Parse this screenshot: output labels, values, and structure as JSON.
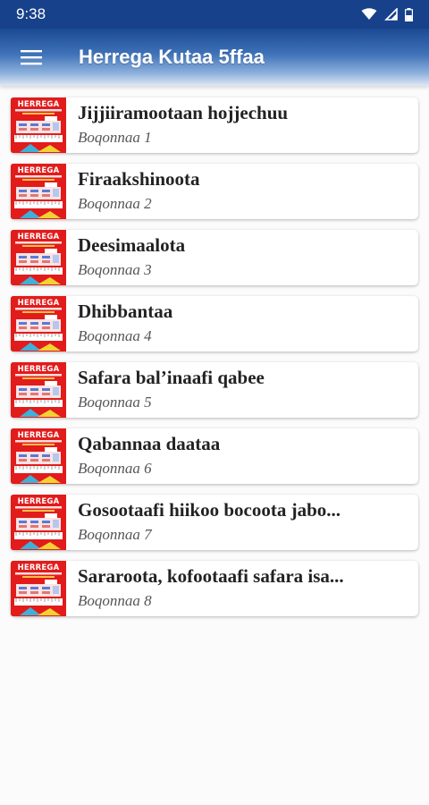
{
  "status": {
    "time": "9:38"
  },
  "appbar": {
    "title": "Herrega Kutaa 5ffaa",
    "menu_icon": "hamburger-menu-icon"
  },
  "colors": {
    "appbar_top": "#1a4a93",
    "thumb_red": "#e21b1b",
    "status_bar": "#17418a"
  },
  "thumbnail": {
    "title": "HERREGA"
  },
  "chapters": [
    {
      "title": "Jijjiiramootaan hojjechuu",
      "subtitle": "Boqonnaa 1"
    },
    {
      "title": "Firaakshinoota",
      "subtitle": "Boqonnaa 2"
    },
    {
      "title": "Deesimaalota",
      "subtitle": "Boqonnaa 3"
    },
    {
      "title": "Dhibbantaa",
      "subtitle": "Boqonnaa 4"
    },
    {
      "title": "Safara bal’inaafi qabee",
      "subtitle": "Boqonnaa 5"
    },
    {
      "title": "Qabannaa daataa",
      "subtitle": "Boqonnaa 6"
    },
    {
      "title": "Gosootaafi hiikoo bocoota jabo...",
      "subtitle": "Boqonnaa 7"
    },
    {
      "title": "Sararoota, kofootaafi safara isa...",
      "subtitle": "Boqonnaa 8"
    }
  ]
}
